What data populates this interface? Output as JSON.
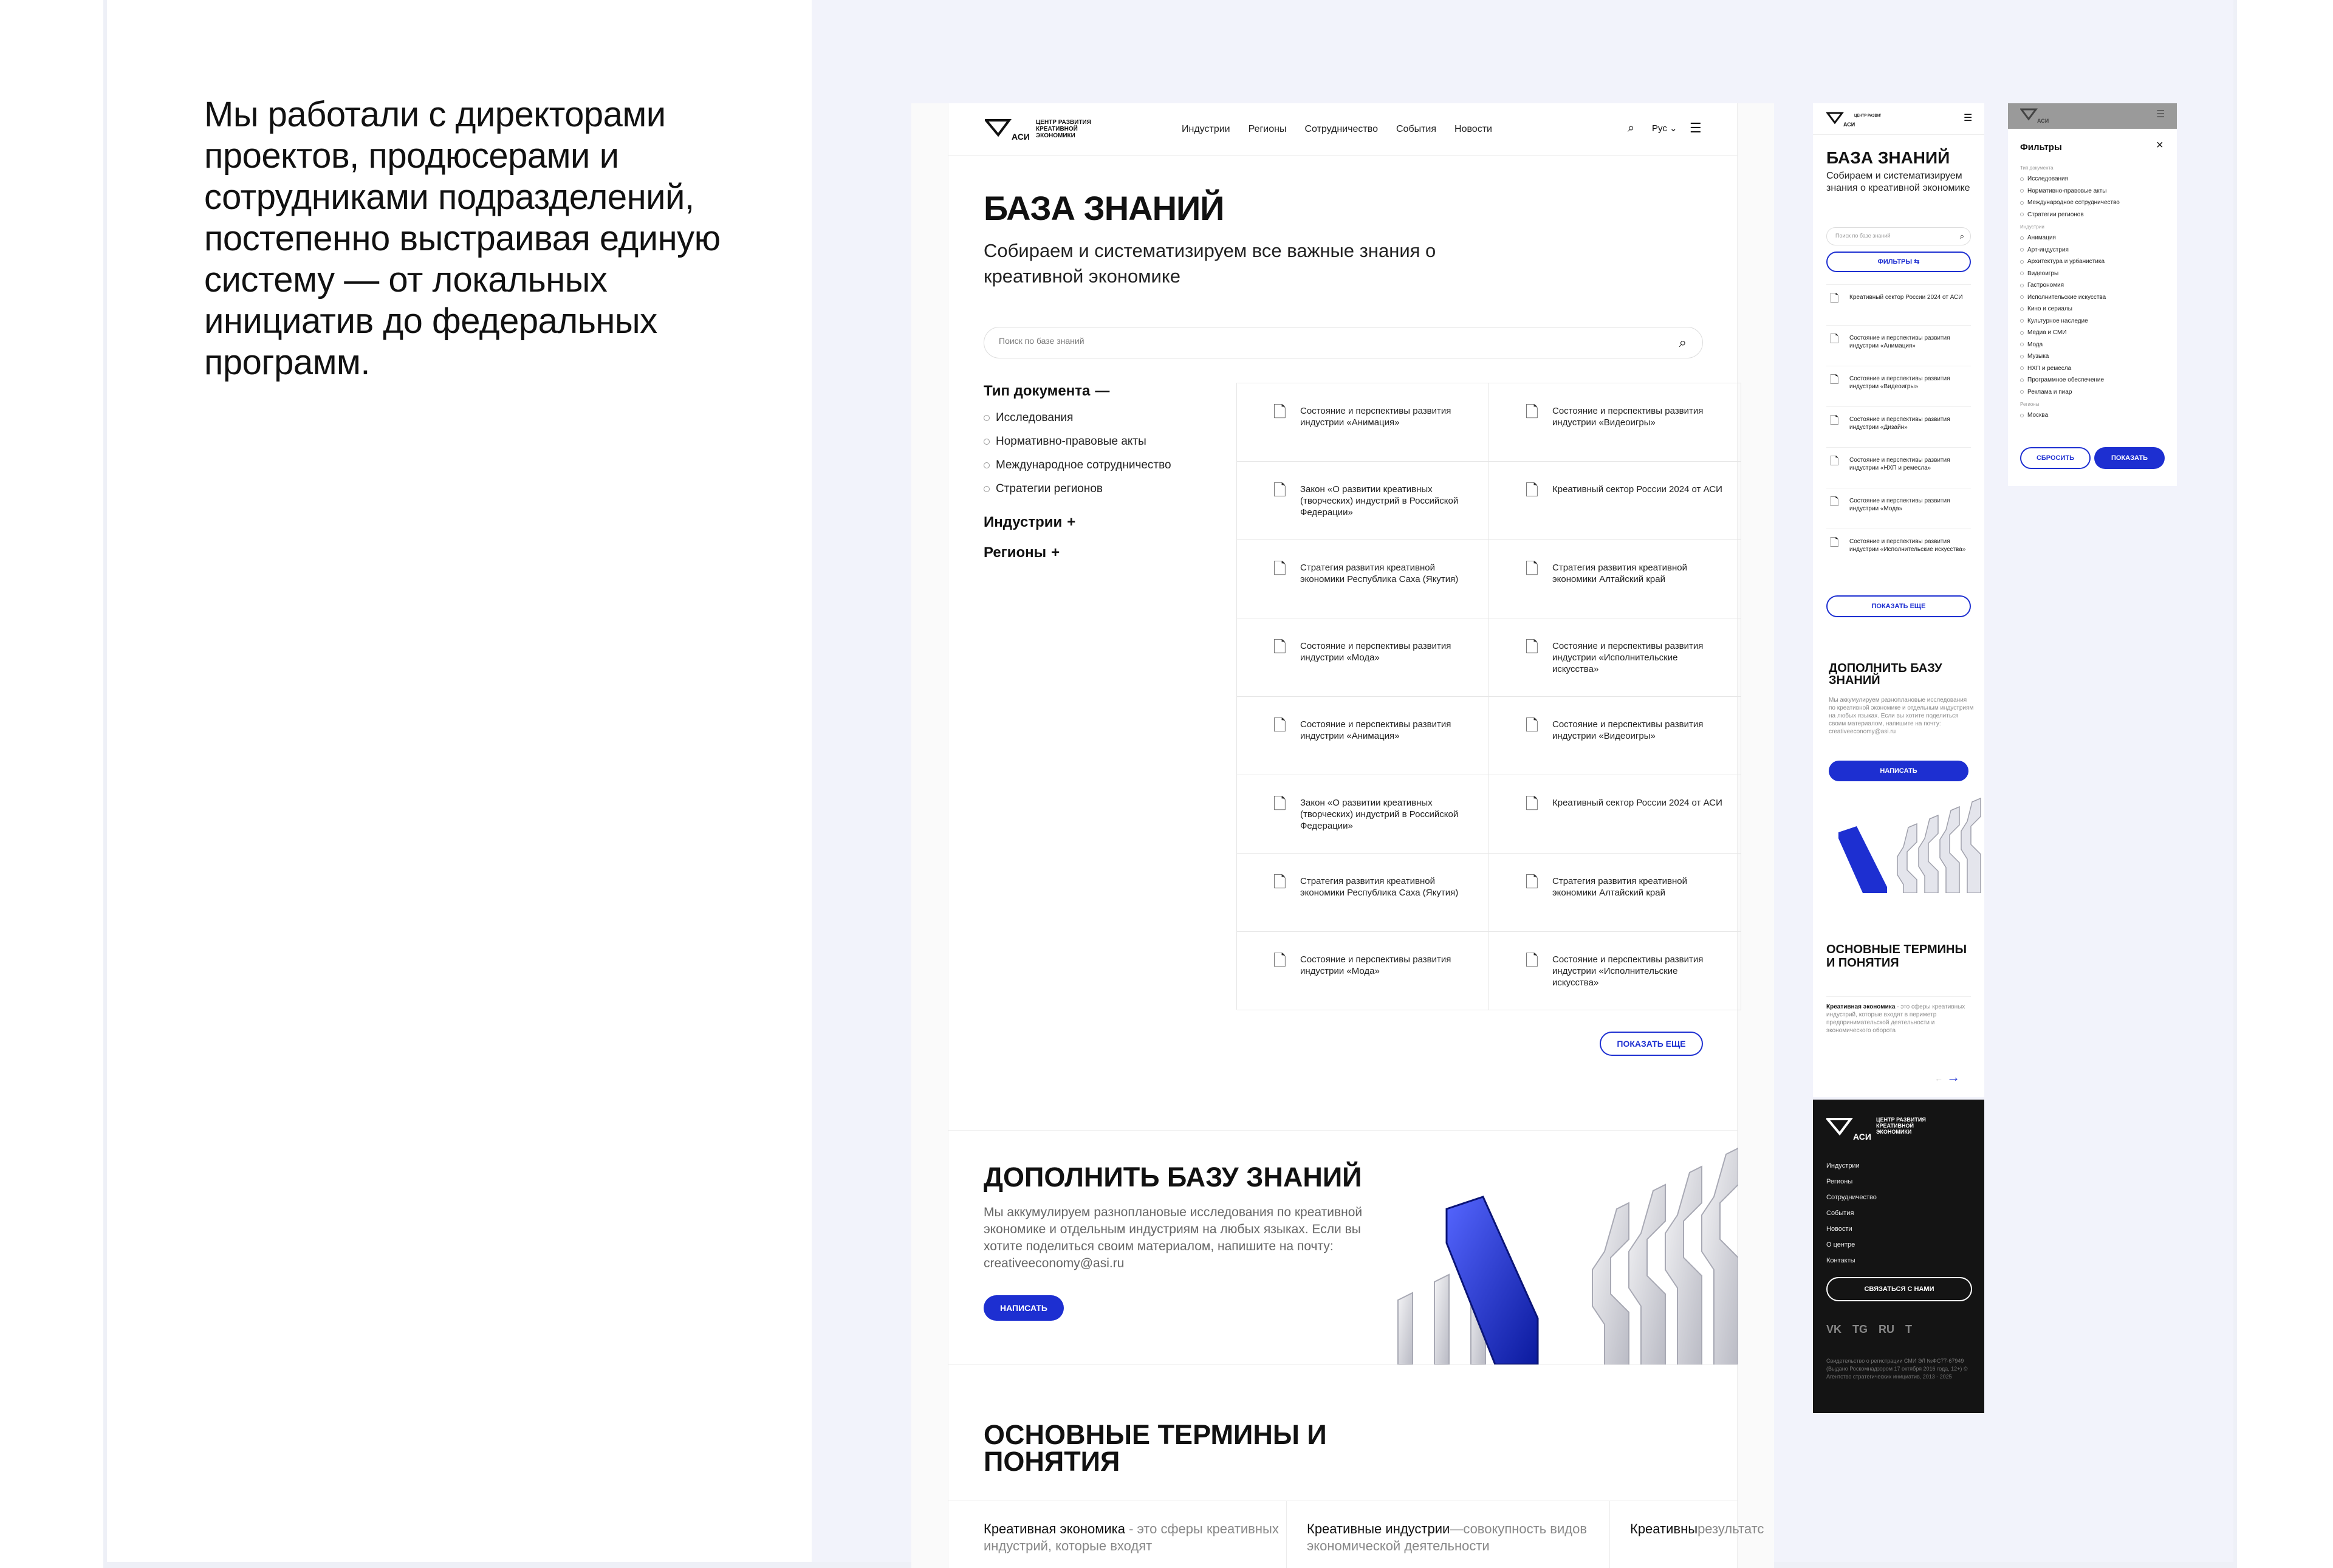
{
  "intro": {
    "text": "Мы работали с директорами проектов, продюсерами и сотрудниками подразделений, постепенно выстраивая единую систему — от локальных инициатив до федеральных программ."
  },
  "brand": {
    "logo_text": "ЦЕНТР РАЗВИТИЯ КРЕАТИВНОЙ ЭКОНОМИКИ",
    "logo_mark": "АСИ",
    "accent_color": "#1d2fd1"
  },
  "desktop": {
    "nav": [
      "Индустрии",
      "Регионы",
      "Сотрудничество",
      "События",
      "Новости"
    ],
    "lang": "Рус",
    "title": "БАЗА ЗНАНИЙ",
    "subtitle": "Собираем и систематизируем все важные знания о креативной экономике",
    "search_placeholder": "Поиск по базе знаний",
    "filters": {
      "doc_type": "Тип документа",
      "doc_types": [
        "Исследования",
        "Нормативно-правовые акты",
        "Международное сотрудничество",
        "Стратегии регионов"
      ],
      "industries": "Индустрии",
      "regions": "Регионы"
    },
    "documents": [
      "Состояние и перспективы развития индустрии «Анимация»",
      "Состояние и перспективы развития индустрии «Видеоигры»",
      "Закон «О развитии креативных (творческих) индустрий в Российской Федерации»",
      "Креативный сектор России 2024 от АСИ",
      "Стратегия развития креативной экономики Республика Саха (Якутия)",
      "Стратегия развития креативной экономики Алтайский край",
      "Состояние и перспективы развития индустрии «Мода»",
      "Состояние и перспективы развития индустрии «Исполнительские искусства»",
      "Состояние и перспективы развития индустрии «Анимация»",
      "Состояние и перспективы развития индустрии «Видеоигры»",
      "Закон «О развитии креативных (творческих) индустрий в Российской Федерации»",
      "Креативный сектор России 2024 от АСИ",
      "Стратегия развития креативной экономики Республика Саха (Якутия)",
      "Стратегия развития креативной экономики Алтайский край",
      "Состояние и перспективы развития индустрии «Мода»",
      "Состояние и перспективы развития индустрии «Исполнительские искусства»"
    ],
    "show_more": "ПОКАЗАТЬ ЕЩЕ",
    "add_title": "ДОПОЛНИТЬ БАЗУ ЗНАНИЙ",
    "add_text": "Мы аккумулируем разноплановые исследования по креативной экономике и отдельным индустриям на любых языках. Если вы хотите поделиться своим материалом, напишите на почту: creativeeconomy@asi.ru",
    "write": "НАПИСАТЬ",
    "terms_title": "ОСНОВНЫЕ ТЕРМИНЫ И ПОНЯТИЯ",
    "terms": [
      {
        "term": "Креативная экономика",
        "text": " - это сферы креативных индустрий, которые входят"
      },
      {
        "term": "Креативные индустрии",
        "text": "—совокупность видов экономической деятельности"
      },
      {
        "term": "Креативны",
        "text": "результатс"
      }
    ]
  },
  "mobile": {
    "title": "БАЗА ЗНАНИЙ",
    "subtitle": "Собираем и систематизируем знания о креативной экономике",
    "search_placeholder": "Поиск по базе знаний",
    "filters": "ФИЛЬТРЫ",
    "documents": [
      "Креативный сектор России 2024 от АСИ",
      "Состояние и перспективы развития индустрии «Анимация»",
      "Состояние и перспективы развития индустрии «Видеоигры»",
      "Состояние и перспективы развития индустрии «Дизайн»",
      "Состояние и перспективы развития индустрии «НХП и ремесла»",
      "Состояние и перспективы развития индустрии «Мода»",
      "Состояние и перспективы развития индустрии «Исполнительские искусства»"
    ],
    "show_more": "ПОКАЗАТЬ ЕЩЕ",
    "add_title": "ДОПОЛНИТЬ БАЗУ ЗНАНИЙ",
    "add_text": "Мы аккумулируем разноплановые исследования по креативной экономике и отдельным индустриям на любых языках. Если вы хотите поделиться своим материалом, напишите на почту: creativeeconomy@asi.ru",
    "write": "НАПИСАТЬ",
    "terms_title": "ОСНОВНЫЕ ТЕРМИНЫ И ПОНЯТИЯ",
    "term": "Креативная экономика",
    "term_text": " - это сферы креативных индустрий, которые входят в периметр предпринимательской деятельности и экономического оборота"
  },
  "footer": {
    "nav": [
      "Индустрии",
      "Регионы",
      "Сотрудничество",
      "События",
      "Новости",
      "О центре",
      "Контакты"
    ],
    "contact": "СВЯЗАТЬСЯ С НАМИ",
    "socials": [
      "VK",
      "TG",
      "RU",
      "T"
    ],
    "legal": "Свидетельство о регистрации СМИ ЭЛ №ФС77-67949 (Выдано Роскомнадзором 17 октября 2016 года, 12+) © Агентство стратегических инициатив, 2013 - 2025"
  },
  "filter_panel": {
    "title": "Фильтры",
    "doc_type_label": "Тип документа",
    "doc_types": [
      "Исследования",
      "Нормативно-правовые акты",
      "Международное сотрудничество",
      "Стратегии регионов"
    ],
    "industries_label": "Индустрии",
    "industries": [
      "Анимация",
      "Арт-индустрия",
      "Архитектура и урбанистика",
      "Видеоигры",
      "Гастрономия",
      "Исполнительские искусства",
      "Кино и сериалы",
      "Культурное наследие",
      "Медиа и СМИ",
      "Мода",
      "Музыка",
      "НХП и ремесла",
      "Программное обеспечение",
      "Реклама и пиар"
    ],
    "regions_label": "Регионы",
    "regions": [
      "Москва"
    ],
    "reset": "СБРОСИТЬ",
    "show": "ПОКАЗАТЬ"
  }
}
